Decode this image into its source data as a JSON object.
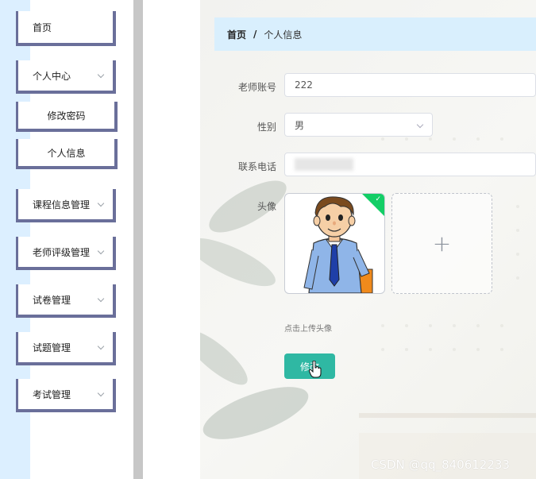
{
  "sidebar": {
    "items": [
      {
        "label": "首页",
        "has_arrow": false
      },
      {
        "label": "个人中心",
        "has_arrow": true
      },
      {
        "label": "修改密码",
        "sub": true
      },
      {
        "label": "个人信息",
        "sub": true
      },
      {
        "label": "课程信息管理",
        "has_arrow": true
      },
      {
        "label": "老师评级管理",
        "has_arrow": true
      },
      {
        "label": "试卷管理",
        "has_arrow": true
      },
      {
        "label": "试题管理",
        "has_arrow": true
      },
      {
        "label": "考试管理",
        "has_arrow": true
      }
    ]
  },
  "breadcrumb": {
    "home": "首页",
    "separator": "/",
    "current": "个人信息"
  },
  "form": {
    "account": {
      "label": "老师账号",
      "value": "222"
    },
    "gender": {
      "label": "性别",
      "value": "男"
    },
    "phone": {
      "label": "联系电话",
      "value": ""
    },
    "avatar": {
      "label": "头像",
      "upload_icon": "+",
      "tip": "点击上传头像"
    },
    "submit_label": "修改"
  },
  "watermark": "CSDN @qq_840612233",
  "colors": {
    "sidebar_accent": "#6a6f9a",
    "breadcrumb_bg": "#d9effd",
    "submit_bg": "#2fb8a3",
    "success_badge": "#13ce66"
  }
}
